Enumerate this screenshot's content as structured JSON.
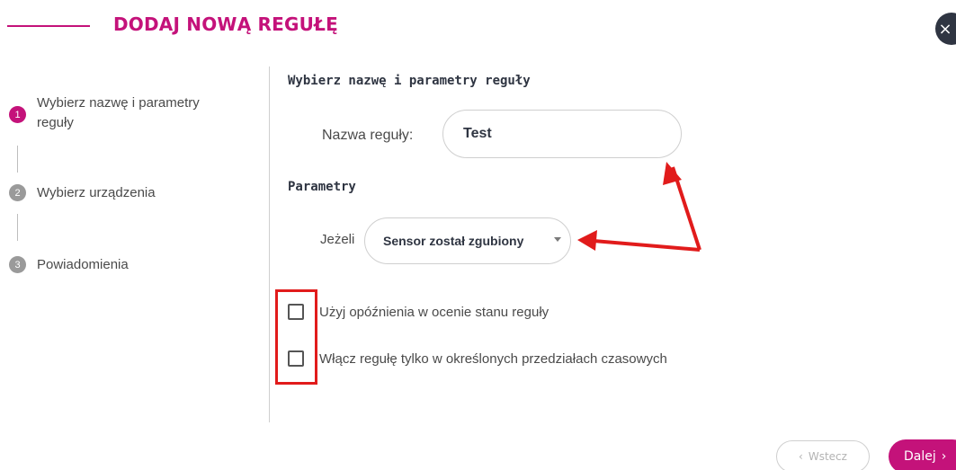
{
  "header": {
    "title": "DODAJ NOWĄ REGUŁĘ",
    "close_icon": "×"
  },
  "steps": [
    {
      "number": "1",
      "label": "Wybierz nazwę i parametry reguły",
      "active": true
    },
    {
      "number": "2",
      "label": "Wybierz urządzenia",
      "active": false
    },
    {
      "number": "3",
      "label": "Powiadomienia",
      "active": false
    }
  ],
  "form": {
    "section_title": "Wybierz nazwę i parametry reguły",
    "name_label": "Nazwa reguły:",
    "name_value": "Test",
    "params_title": "Parametry",
    "if_label": "Jeżeli",
    "condition_selected": "Sensor został zgubiony",
    "options": [
      {
        "label": "Użyj opóźnienia w ocenie stanu reguły",
        "checked": false
      },
      {
        "label": "Włącz regułę tylko w określonych przedziałach czasowych",
        "checked": false
      }
    ]
  },
  "footer": {
    "back_label": "Wstecz",
    "back_icon": "‹",
    "next_label": "Dalej",
    "next_icon": "›"
  },
  "colors": {
    "accent": "#c4127a",
    "annotation": "#e11b1b",
    "close_bg": "#2f3542"
  }
}
